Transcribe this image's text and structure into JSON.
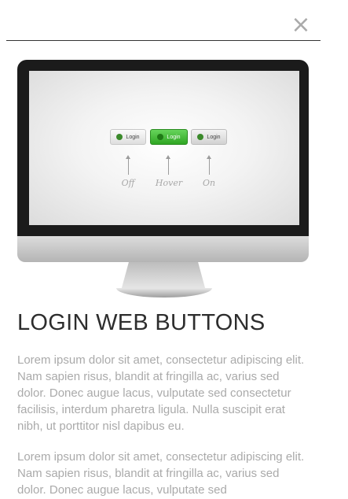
{
  "header": {
    "close_icon": "close-icon",
    "close_glyph": "×"
  },
  "article": {
    "title": "LOGIN WEB BUTTONS",
    "paragraphs": [
      "Lorem ipsum dolor sit amet, consectetur adipiscing elit. Nam sapien risus, blandit at fringilla ac, varius sed dolor. Donec augue lacus, vulputate sed consectetur facilisis, interdum pharetra ligula. Nulla suscipit erat nibh, ut porttitor nisl dapibus eu.",
      "Lorem ipsum dolor sit amet, consectetur adipiscing elit. Nam sapien risus, blandit at fringilla ac, varius sed dolor. Donec augue lacus, vulputate sed"
    ]
  },
  "preview": {
    "buttons": [
      {
        "label": "Login",
        "state": "Off"
      },
      {
        "label": "Login",
        "state": "Hover"
      },
      {
        "label": "Login",
        "state": "On"
      }
    ]
  },
  "colors": {
    "hover_green": "#3cb832",
    "title_text": "#2d2d2d",
    "body_text": "#aaaaaa"
  }
}
